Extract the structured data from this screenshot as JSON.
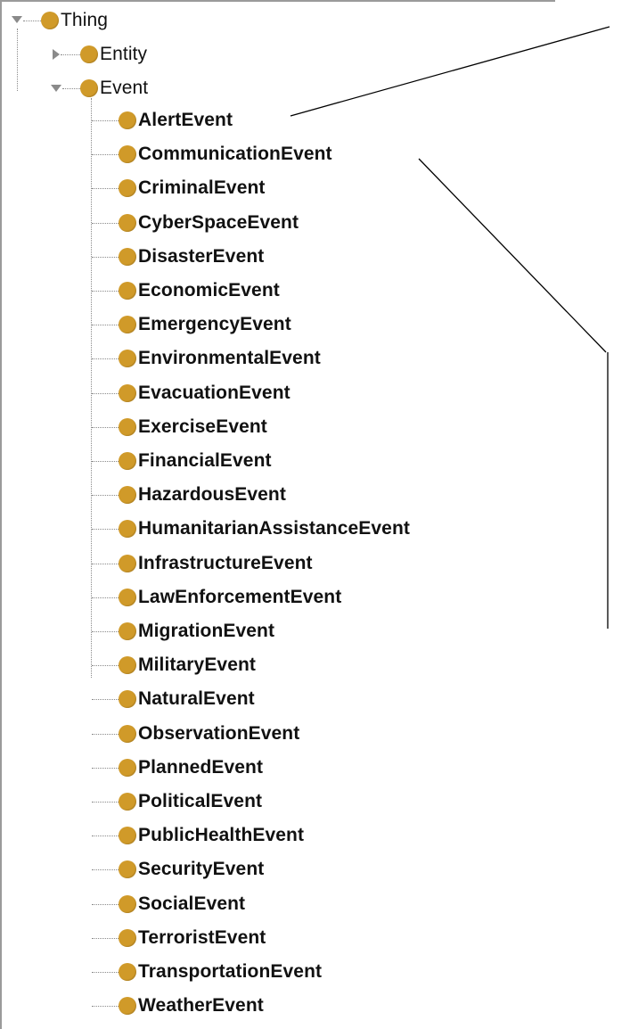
{
  "tree": {
    "root": {
      "label": "Thing",
      "expanded": true
    },
    "children": [
      {
        "label": "Entity",
        "expanded": false
      },
      {
        "label": "Event",
        "expanded": true
      }
    ],
    "event_subclasses": [
      "AlertEvent",
      "CommunicationEvent",
      "CriminalEvent",
      "CyberSpaceEvent",
      "DisasterEvent",
      "EconomicEvent",
      "EmergencyEvent",
      "EnvironmentalEvent",
      "EvacuationEvent",
      "ExerciseEvent",
      "FinancialEvent",
      "HazardousEvent",
      "HumanitarianAssistanceEvent",
      "InfrastructureEvent",
      "LawEnforcementEvent",
      "MigrationEvent",
      "MilitaryEvent",
      "NaturalEvent",
      "ObservationEvent",
      "PlannedEvent",
      "PoliticalEvent",
      "PublicHealthEvent",
      "SecurityEvent",
      "SocialEvent",
      "TerroristEvent",
      "TransportationEvent",
      "WeatherEvent"
    ]
  },
  "colors": {
    "class_dot": "#d09a29",
    "connector": "#8a8a8a",
    "callout": "#000000"
  }
}
